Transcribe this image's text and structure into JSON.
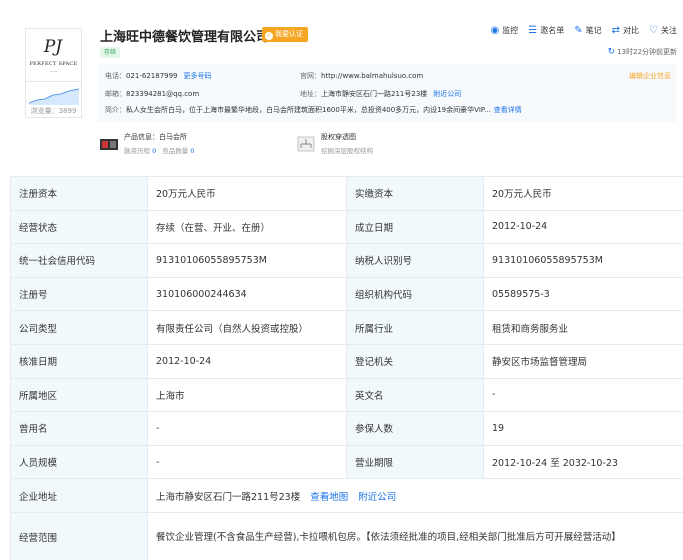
{
  "company": {
    "name": "上海旺中德餐饮管理有限公司",
    "claim_label": "我要认证",
    "status": "存续",
    "update_time": "13时22分钟前更新"
  },
  "logo": {
    "mark": "PJ",
    "text": "PERFECT SPACE",
    "subtext": "——",
    "view_count": "浏览量：3899"
  },
  "actions": [
    {
      "icon": "eye-icon",
      "label": "监控"
    },
    {
      "icon": "note-icon",
      "label": "邀名单"
    },
    {
      "icon": "pen-icon",
      "label": "笔记"
    },
    {
      "icon": "compare-icon",
      "label": "对比"
    },
    {
      "icon": "heart-icon",
      "label": "关注"
    }
  ],
  "contact": {
    "phone_label": "电话：",
    "phone": "021-62187999",
    "more_phone": "更多号码",
    "website_label": "官网：",
    "website": "http://www.balmahulsuo.com",
    "email_label": "邮箱：",
    "email": "823394281@qq.com",
    "address_label": "地址：",
    "address": "上海市静安区石门一路211号23楼",
    "nearby": "附近公司",
    "edit": "编辑企业信息",
    "intro_label": "简介：",
    "intro": "私人女生会所白马，位于上海市最繁华地段，白马会所建筑面积1600平米，总投资400多万元，内设19余间豪华VIP...",
    "intro_more": "查看详情"
  },
  "extras": [
    {
      "title": "产品信息：白马会所",
      "sub1": "融资历程",
      "num1": "0",
      "sub2": "竞品数量",
      "num2": "0"
    },
    {
      "title": "股权穿透图",
      "sub1": "挖掘深层股权结构"
    }
  ],
  "colors": {
    "accent": "#1a73e8",
    "badge": "#f5a623",
    "status_green": "#33a45d",
    "key_bg": "#f2f9fc"
  },
  "table": [
    {
      "k1": "注册资本",
      "v1": "20万元人民币",
      "k2": "实缴资本",
      "v2": "20万元人民币"
    },
    {
      "k1": "经营状态",
      "v1": "存续（在营、开业、在册）",
      "k2": "成立日期",
      "v2": "2012-10-24"
    },
    {
      "k1": "统一社会信用代码",
      "v1": "91310106055895753M",
      "k2": "纳税人识别号",
      "v2": "91310106055895753M"
    },
    {
      "k1": "注册号",
      "v1": "310106000244634",
      "k2": "组织机构代码",
      "v2": "05589575-3"
    },
    {
      "k1": "公司类型",
      "v1": "有限责任公司（自然人投资或控股）",
      "k2": "所属行业",
      "v2": "租赁和商务服务业"
    },
    {
      "k1": "核准日期",
      "v1": "2012-10-24",
      "k2": "登记机关",
      "v2": "静安区市场监督管理局"
    },
    {
      "k1": "所属地区",
      "v1": "上海市",
      "k2": "英文名",
      "v2": "-"
    },
    {
      "k1": "曾用名",
      "v1": "-",
      "k2": "参保人数",
      "v2": "19"
    },
    {
      "k1": "人员规模",
      "v1": "-",
      "k2": "营业期限",
      "v2": "2012-10-24 至 2032-10-23"
    }
  ],
  "address_row": {
    "k": "企业地址",
    "v": "上海市静安区石门一路211号23楼",
    "map": "查看地图",
    "nearby": "附近公司"
  },
  "scope_row": {
    "k": "经营范围",
    "v": "餐饮企业管理(不含食品生产经营),卡拉喂机包房。【依法须经批准的项目,经相关部门批准后方可开展经营活动】"
  }
}
